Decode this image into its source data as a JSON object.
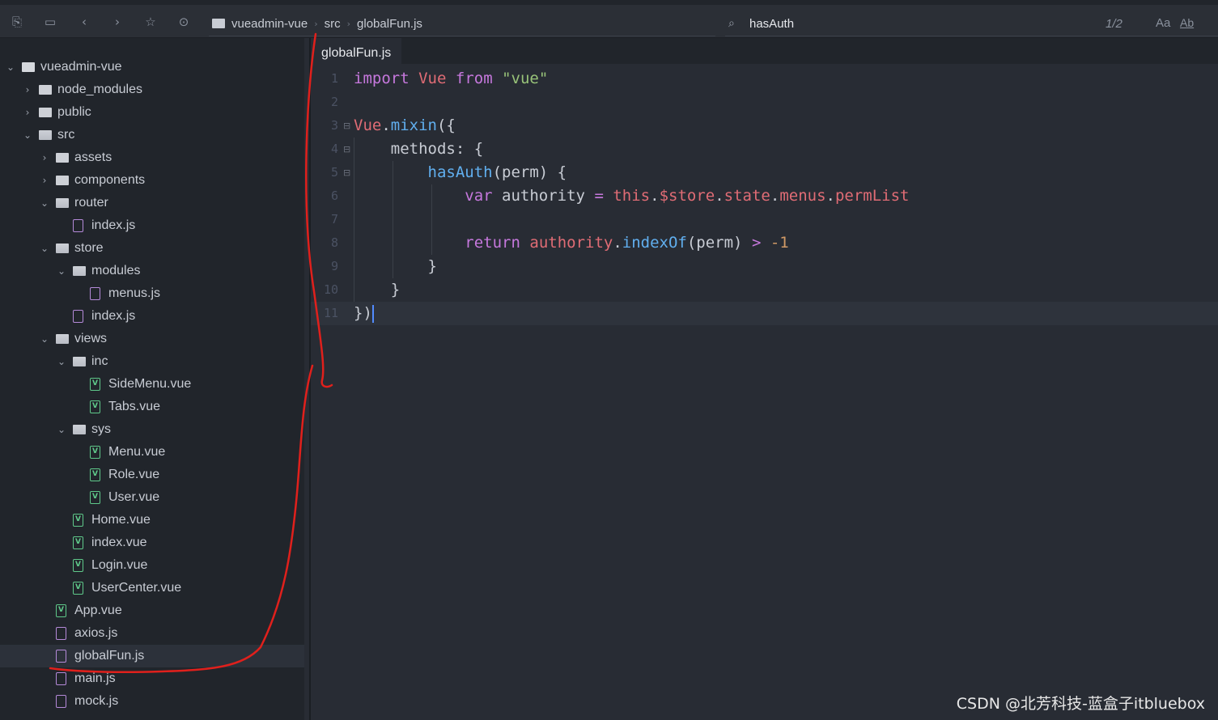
{
  "toolbar": {
    "icons": [
      "save-to-disk-icon",
      "save-icon",
      "back-arrow-icon",
      "forward-arrow-icon",
      "star-icon",
      "run-icon"
    ],
    "breadcrumb": [
      "vueadmin-vue",
      "src",
      "globalFun.js"
    ]
  },
  "search": {
    "query": "hasAuth",
    "count": "1/2",
    "match_case_label": "Aa",
    "whole_word_label": "Ab"
  },
  "sidebar": {
    "items": [
      {
        "label": "vueadmin-vue",
        "type": "root",
        "depth": 0,
        "expanded": true
      },
      {
        "label": "node_modules",
        "type": "folder",
        "depth": 1,
        "expanded": false
      },
      {
        "label": "public",
        "type": "folder",
        "depth": 1,
        "expanded": false
      },
      {
        "label": "src",
        "type": "folder",
        "depth": 1,
        "expanded": true
      },
      {
        "label": "assets",
        "type": "folder",
        "depth": 2,
        "expanded": false
      },
      {
        "label": "components",
        "type": "folder",
        "depth": 2,
        "expanded": false
      },
      {
        "label": "router",
        "type": "folder",
        "depth": 2,
        "expanded": true
      },
      {
        "label": "index.js",
        "type": "js",
        "depth": 3
      },
      {
        "label": "store",
        "type": "folder",
        "depth": 2,
        "expanded": true
      },
      {
        "label": "modules",
        "type": "folder",
        "depth": 3,
        "expanded": true
      },
      {
        "label": "menus.js",
        "type": "js",
        "depth": 4
      },
      {
        "label": "index.js",
        "type": "js",
        "depth": 3
      },
      {
        "label": "views",
        "type": "folder",
        "depth": 2,
        "expanded": true
      },
      {
        "label": "inc",
        "type": "folder",
        "depth": 3,
        "expanded": true
      },
      {
        "label": "SideMenu.vue",
        "type": "vue",
        "depth": 4
      },
      {
        "label": "Tabs.vue",
        "type": "vue",
        "depth": 4
      },
      {
        "label": "sys",
        "type": "folder",
        "depth": 3,
        "expanded": true
      },
      {
        "label": "Menu.vue",
        "type": "vue",
        "depth": 4
      },
      {
        "label": "Role.vue",
        "type": "vue",
        "depth": 4
      },
      {
        "label": "User.vue",
        "type": "vue",
        "depth": 4
      },
      {
        "label": "Home.vue",
        "type": "vue",
        "depth": 3
      },
      {
        "label": "index.vue",
        "type": "vue",
        "depth": 3
      },
      {
        "label": "Login.vue",
        "type": "vue",
        "depth": 3
      },
      {
        "label": "UserCenter.vue",
        "type": "vue",
        "depth": 3
      },
      {
        "label": "App.vue",
        "type": "vue",
        "depth": 2
      },
      {
        "label": "axios.js",
        "type": "js",
        "depth": 2
      },
      {
        "label": "globalFun.js",
        "type": "js",
        "depth": 2,
        "selected": true
      },
      {
        "label": "main.js",
        "type": "js",
        "depth": 2
      },
      {
        "label": "mock.js",
        "type": "js",
        "depth": 2
      }
    ]
  },
  "editor": {
    "tab_label": "globalFun.js",
    "current_line": 11,
    "lines": [
      {
        "n": "1",
        "tokens": [
          [
            "kw",
            "import"
          ],
          [
            "pl",
            " "
          ],
          [
            "cls",
            "Vue"
          ],
          [
            "pl",
            " "
          ],
          [
            "kw",
            "from"
          ],
          [
            "pl",
            " "
          ],
          [
            "str",
            "\"vue\""
          ]
        ]
      },
      {
        "n": "2",
        "tokens": []
      },
      {
        "n": "3",
        "fold": true,
        "tokens": [
          [
            "cls",
            "Vue"
          ],
          [
            "pl",
            "."
          ],
          [
            "fn",
            "mixin"
          ],
          [
            "pl",
            "({"
          ]
        ]
      },
      {
        "n": "4",
        "fold": true,
        "tokens": [
          [
            "pl",
            "    methods: {"
          ]
        ]
      },
      {
        "n": "5",
        "fold": true,
        "tokens": [
          [
            "pl",
            "        "
          ],
          [
            "fn",
            "hasAuth"
          ],
          [
            "pl",
            "(perm) {"
          ]
        ]
      },
      {
        "n": "6",
        "tokens": [
          [
            "pl",
            "            "
          ],
          [
            "kw",
            "var"
          ],
          [
            "pl",
            " authority "
          ],
          [
            "kw",
            "="
          ],
          [
            "pl",
            " "
          ],
          [
            "cls",
            "this"
          ],
          [
            "pl",
            "."
          ],
          [
            "pr",
            "$store"
          ],
          [
            "pl",
            "."
          ],
          [
            "pr",
            "state"
          ],
          [
            "pl",
            "."
          ],
          [
            "pr",
            "menus"
          ],
          [
            "pl",
            "."
          ],
          [
            "pr",
            "permList"
          ]
        ]
      },
      {
        "n": "7",
        "tokens": []
      },
      {
        "n": "8",
        "tokens": [
          [
            "pl",
            "            "
          ],
          [
            "kw",
            "return"
          ],
          [
            "pl",
            " "
          ],
          [
            "pr",
            "authority"
          ],
          [
            "pl",
            "."
          ],
          [
            "fn",
            "indexOf"
          ],
          [
            "pl",
            "(perm) "
          ],
          [
            "kw",
            ">"
          ],
          [
            "pl",
            " "
          ],
          [
            "num",
            "-1"
          ]
        ]
      },
      {
        "n": "9",
        "tokens": [
          [
            "pl",
            "        }"
          ]
        ]
      },
      {
        "n": "10",
        "tokens": [
          [
            "pl",
            "    }"
          ]
        ]
      },
      {
        "n": "11",
        "cursor": true,
        "tokens": [
          [
            "pl",
            "})"
          ]
        ]
      }
    ]
  },
  "watermark": "CSDN @北芳科技-蓝盒子itbluebox",
  "colors": {
    "background": "#282c34",
    "sidebar": "#21252b",
    "annotation": "#e0201c"
  }
}
